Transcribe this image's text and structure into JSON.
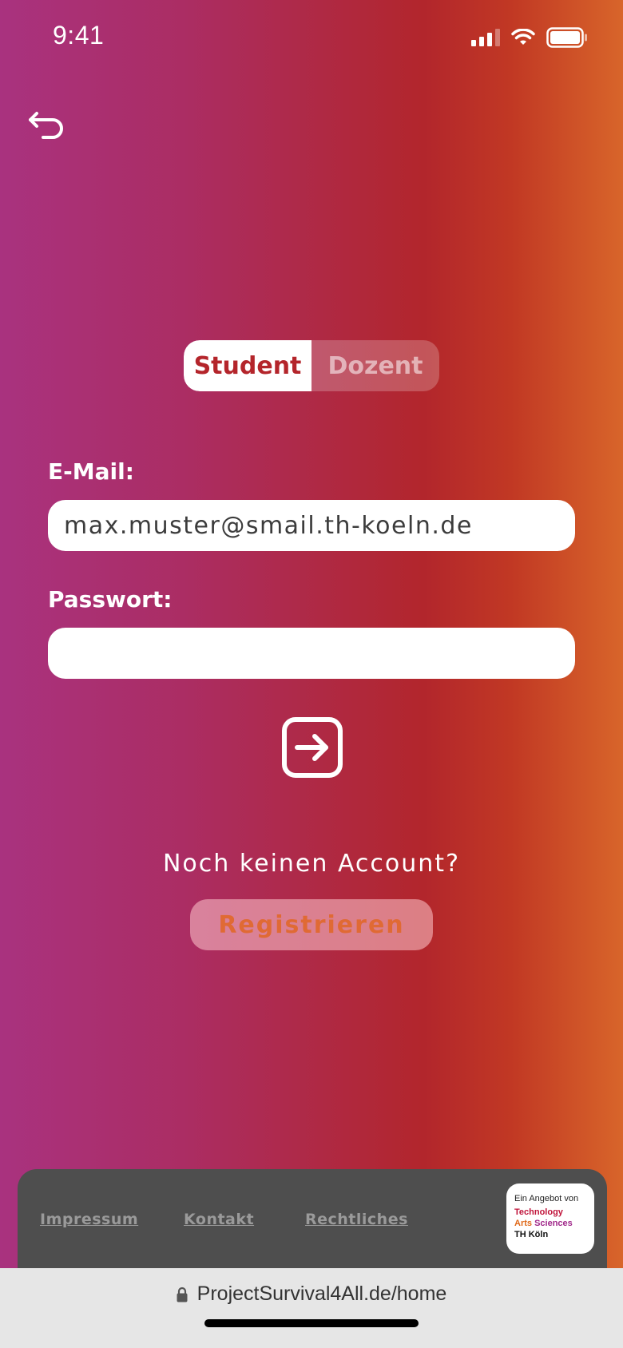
{
  "status": {
    "time": "9:41"
  },
  "role_toggle": {
    "student": "Student",
    "dozent": "Dozent"
  },
  "form": {
    "email_label": "E-Mail:",
    "email_value": "max.muster@smail.th-koeln.de",
    "password_label": "Passwort:",
    "password_value": ""
  },
  "register": {
    "prompt": "Noch keinen Account?",
    "button": "Registrieren"
  },
  "footer": {
    "links": [
      "Impressum",
      "Kontakt",
      "Rechtliches"
    ],
    "logo": {
      "line1": "Ein Angebot von",
      "line2": "Technology",
      "line3a": "Arts",
      "line3b": "Sciences",
      "line4": "TH Köln"
    }
  },
  "browser": {
    "url": "ProjectSurvival4All.de/home"
  },
  "colors": {
    "accent": "#b4252b",
    "footer_bg": "#4e4e4e",
    "register_text": "#e06a34"
  },
  "icons": [
    "back-arrow-icon",
    "login-arrow-icon",
    "lock-icon",
    "wifi-icon",
    "battery-icon",
    "signal-icon"
  ]
}
